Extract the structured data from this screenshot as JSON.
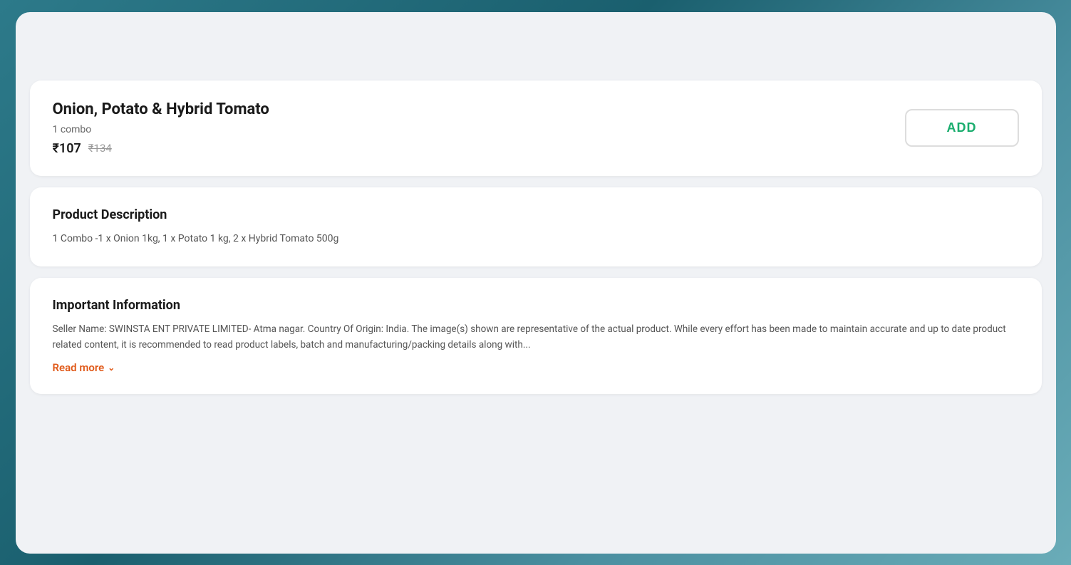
{
  "background": {
    "gradient_start": "#2d7a8a",
    "gradient_end": "#6aacb8"
  },
  "product_section": {
    "title": "Onion, Potato & Hybrid Tomato",
    "quantity": "1 combo",
    "price_current": "₹107",
    "price_original": "₹134",
    "add_button_label": "ADD"
  },
  "description_section": {
    "title": "Product Description",
    "body": "1 Combo -1 x Onion 1kg, 1 x Potato 1 kg, 2 x Hybrid Tomato 500g"
  },
  "important_info_section": {
    "title": "Important Information",
    "body": "Seller Name: SWINSTA ENT PRIVATE LIMITED- Atma nagar. Country Of Origin: India. The image(s) shown are representative of the actual product. While every effort has been made to maintain accurate and up to date product related content, it is recommended to read product labels, batch and manufacturing/packing details along with...",
    "read_more_label": "Read more",
    "chevron_icon": "chevron-down"
  }
}
